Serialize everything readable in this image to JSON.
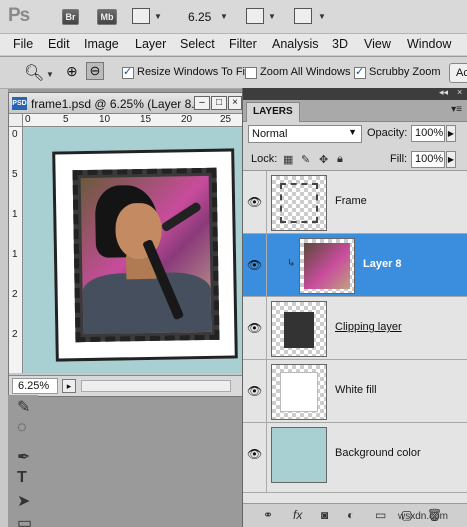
{
  "app": {
    "logo": "Ps",
    "bridge_label": "Br",
    "minibridge_label": "Mb",
    "zoom_level": "6.25"
  },
  "menu": [
    "File",
    "Edit",
    "Image",
    "Layer",
    "Select",
    "Filter",
    "Analysis",
    "3D",
    "View",
    "Window"
  ],
  "options": {
    "resize_windows": {
      "label": "Resize Windows To Fit",
      "checked": true
    },
    "zoom_all": {
      "label": "Zoom All Windows",
      "checked": false
    },
    "scrubby_zoom": {
      "label": "Scrubby Zoom",
      "checked": true
    },
    "actual_pixels_button": "Ac"
  },
  "document": {
    "title": "frame1.psd @ 6.25% (Layer 8...",
    "zoom_status": "6.25%",
    "ruler_h_ticks": [
      "0",
      "5",
      "10",
      "15",
      "20",
      "25"
    ],
    "ruler_v_ticks": [
      "0",
      "5",
      "1",
      "1",
      "2",
      "2"
    ]
  },
  "layers_panel": {
    "tab_label": "LAYERS",
    "blend_mode": "Normal",
    "opacity_label": "Opacity:",
    "opacity_value": "100%",
    "lock_label": "Lock:",
    "fill_label": "Fill:",
    "fill_value": "100%",
    "layers": [
      {
        "name": "Frame",
        "visible": true,
        "selected": false
      },
      {
        "name": "Layer 8",
        "visible": true,
        "selected": true
      },
      {
        "name": "Clipping layer",
        "visible": true,
        "selected": false
      },
      {
        "name": "White fill",
        "visible": true,
        "selected": false
      },
      {
        "name": "Background color",
        "visible": true,
        "selected": false
      }
    ]
  },
  "colors": {
    "selection": "#3b8ede",
    "canvas_bg": "#a8d0d2"
  },
  "watermark": "wsxdn.com"
}
